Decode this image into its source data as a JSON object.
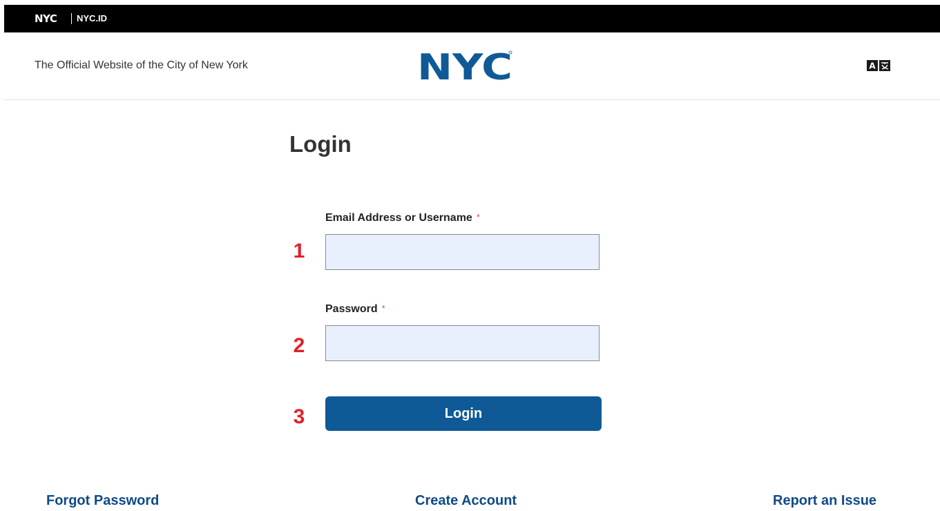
{
  "topbar": {
    "logo_text": "NYC",
    "app_name": "NYC.ID"
  },
  "header": {
    "tagline": "The Official Website of the City of New York",
    "logo_text": "NYC",
    "logo_color": "#0f5a96",
    "translate_icon": "translate-icon"
  },
  "main": {
    "title": "Login",
    "email_field": {
      "label": "Email Address or Username",
      "required_marker": "*",
      "value": "",
      "placeholder": ""
    },
    "password_field": {
      "label": "Password",
      "required_marker": "*",
      "value": "",
      "placeholder": ""
    },
    "login_button_label": "Login",
    "steps": [
      "1",
      "2",
      "3"
    ],
    "accent_color": "#0f5a96",
    "step_color": "#e0202a"
  },
  "footer": {
    "forgot_password": "Forgot Password",
    "create_account": "Create Account",
    "report_issue": "Report an Issue"
  }
}
